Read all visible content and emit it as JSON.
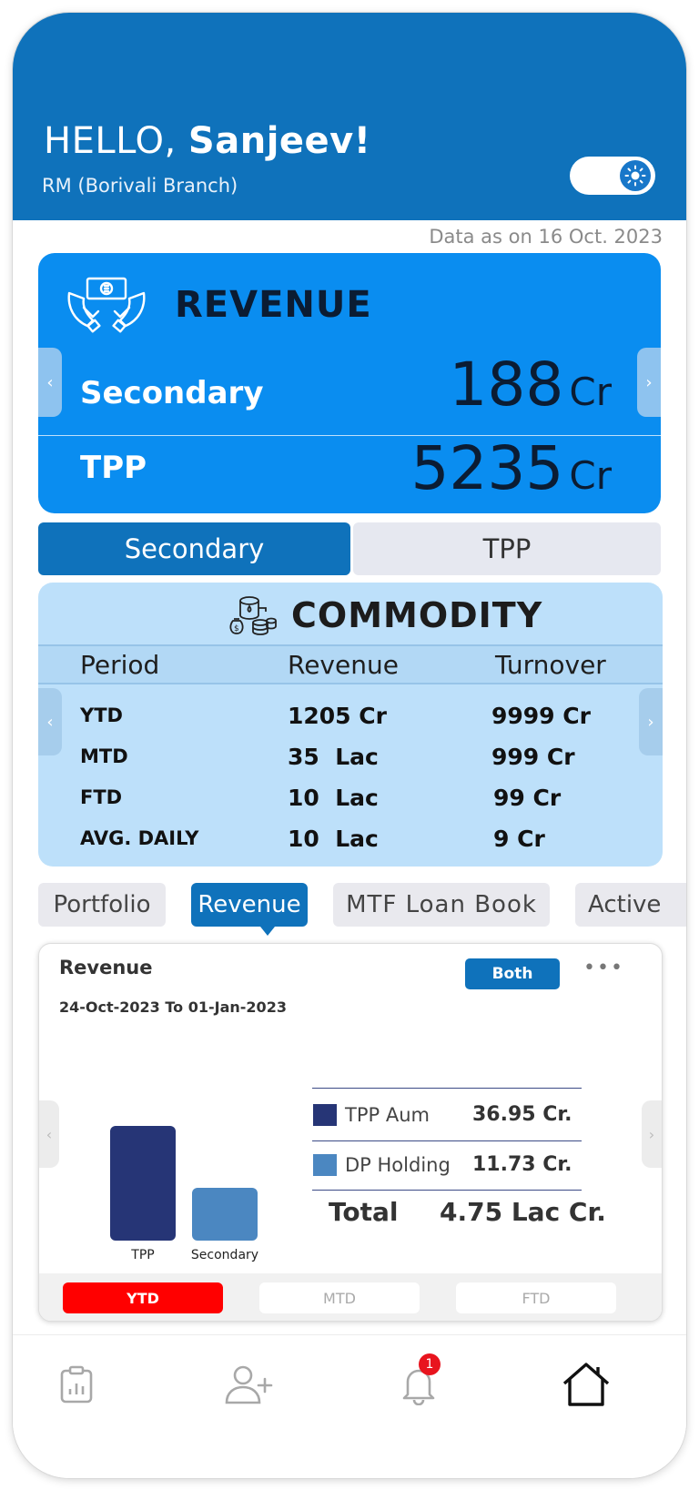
{
  "header": {
    "greeting": "HELLO,",
    "name": "Sanjeev!",
    "role": "RM (Borivali Branch)"
  },
  "data_as_on": "Data as on 16 Oct. 2023",
  "revenue_card": {
    "title": "REVENUE",
    "rows": [
      {
        "label": "Secondary",
        "value": "188",
        "unit": "Cr"
      },
      {
        "label": "TPP",
        "value": "5235",
        "unit": "Cr"
      }
    ]
  },
  "segment": {
    "active": "Secondary",
    "inactive": "TPP"
  },
  "commodity": {
    "title": "COMMODITY",
    "headers": [
      "Period",
      "Revenue",
      "Turnover"
    ],
    "rows": [
      {
        "period": "YTD",
        "revenue": "1205 Cr",
        "turnover": "9999 Cr"
      },
      {
        "period": "MTD",
        "revenue": "35  Lac",
        "turnover": "999 Cr"
      },
      {
        "period": "FTD",
        "revenue": "10  Lac",
        "turnover": "99 Cr"
      },
      {
        "period": "AVG. DAILY",
        "revenue": "10  Lac",
        "turnover": "9 Cr"
      }
    ]
  },
  "chips": [
    "Portfolio",
    "Revenue",
    "MTF Loan Book",
    "Active"
  ],
  "chart_card": {
    "title": "Revenue",
    "range": "24-Oct-2023 To 01-Jan-2023",
    "filter": "Both",
    "more": "•••",
    "legend": [
      {
        "label": "TPP Aum",
        "value": "36.95 Cr.",
        "color": "#263576"
      },
      {
        "label": "DP Holding",
        "value": "11.73 Cr.",
        "color": "#4b87c1"
      }
    ],
    "total_label": "Total",
    "total_value": "4.75 Lac Cr.",
    "periods": [
      "YTD",
      "MTD",
      "FTD"
    ]
  },
  "chart_data": {
    "type": "bar",
    "categories": [
      "TPP",
      "Secondary"
    ],
    "values": [
      100,
      46
    ],
    "colors": [
      "#263576",
      "#4b87c1"
    ],
    "title": "",
    "xlabel": "",
    "ylabel": ""
  },
  "nav": {
    "items": [
      "report-icon",
      "add-user-icon",
      "bell-icon",
      "home-icon"
    ],
    "badge": "1"
  },
  "colors": {
    "primary": "#0f72bb",
    "card_blue": "#0a8df0",
    "commodity_bg": "#bde0fa",
    "ytd_red": "#ff0000"
  }
}
